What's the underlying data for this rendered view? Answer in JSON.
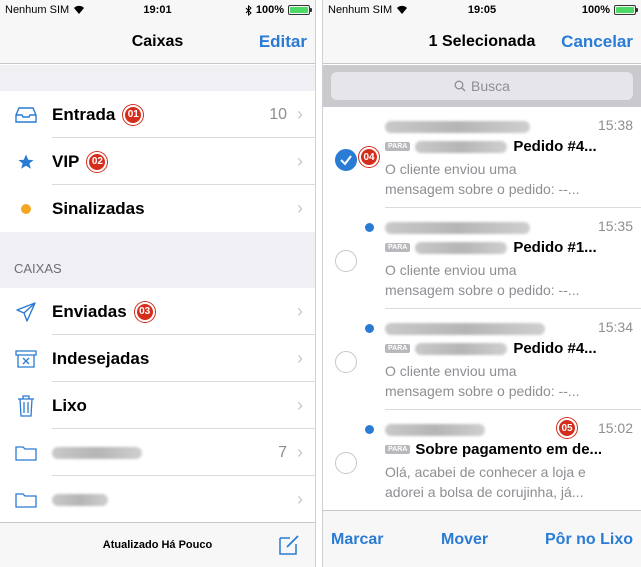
{
  "left": {
    "status": {
      "carrier": "Nenhum SIM",
      "time": "19:01",
      "battery": "100%"
    },
    "nav": {
      "title": "Caixas",
      "action": "Editar"
    },
    "inboxes": [
      {
        "label": "Entrada",
        "count": "10",
        "icon": "tray-icon",
        "badge": "01"
      },
      {
        "label": "VIP",
        "count": "",
        "icon": "star-icon",
        "badge": "02"
      },
      {
        "label": "Sinalizadas",
        "count": "",
        "icon": "flag-dot-icon",
        "badge": ""
      }
    ],
    "section_title": "CAIXAS",
    "mailboxes": [
      {
        "label": "Enviadas",
        "count": "",
        "icon": "send-icon",
        "badge": "03"
      },
      {
        "label": "Indesejadas",
        "count": "",
        "icon": "junk-icon",
        "badge": ""
      },
      {
        "label": "Lixo",
        "count": "",
        "icon": "trash-icon",
        "badge": ""
      },
      {
        "label": "",
        "count": "7",
        "icon": "folder-icon",
        "badge": ""
      },
      {
        "label": "",
        "count": "",
        "icon": "folder-icon",
        "badge": ""
      }
    ],
    "toolbar": {
      "updated": "Atualizado Há Pouco"
    }
  },
  "right": {
    "status": {
      "carrier": "Nenhum SIM",
      "time": "19:05",
      "battery": "100%"
    },
    "nav": {
      "title": "1 Selecionada",
      "action": "Cancelar"
    },
    "search_placeholder": "Busca",
    "messages": [
      {
        "time": "15:38",
        "subject": "Pedido #4...",
        "preview1": "O cliente enviou uma",
        "preview2": "mensagem sobre o pedido: --...",
        "selected": true,
        "unread": false,
        "badge": "04"
      },
      {
        "time": "15:35",
        "subject": "Pedido #1...",
        "preview1": "O cliente enviou uma",
        "preview2": "mensagem sobre o pedido: --...",
        "selected": false,
        "unread": true,
        "badge": ""
      },
      {
        "time": "15:34",
        "subject": "Pedido #4...",
        "preview1": "O cliente enviou uma",
        "preview2": "mensagem sobre o pedido: --...",
        "selected": false,
        "unread": true,
        "badge": ""
      },
      {
        "time": "15:02",
        "subject": "Sobre pagamento em de...",
        "preview1": "Olá, acabei de conhecer a loja e",
        "preview2": "adorei a bolsa de corujinha, já...",
        "selected": false,
        "unread": true,
        "badge": "05"
      }
    ],
    "para_tag": "PARA",
    "toolbar": {
      "mark": "Marcar",
      "move": "Mover",
      "trash": "Pôr no Lixo"
    }
  },
  "colors": {
    "accent": "#2a7bd4",
    "badge": "#d42d1c",
    "flag": "#f5a623"
  }
}
